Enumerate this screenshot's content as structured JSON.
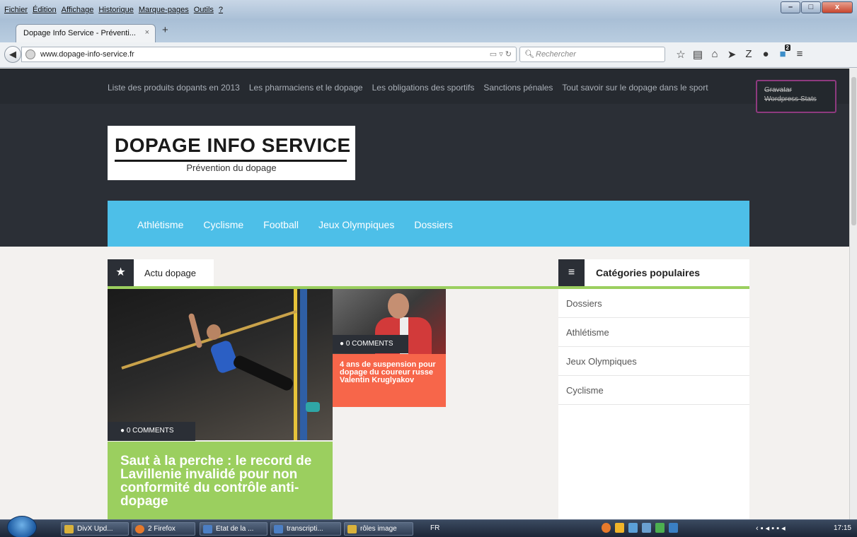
{
  "menubar": {
    "items": [
      "Fichier",
      "Édition",
      "Affichage",
      "Historique",
      "Marque-pages",
      "Outils",
      "?"
    ]
  },
  "tabs": [
    {
      "title": "Dopage Info Service - Préventi...",
      "close": "×"
    }
  ],
  "newtab": "+",
  "urlbar": {
    "url": "www.dopage-info-service.fr"
  },
  "search": {
    "placeholder": "Rechercher"
  },
  "toolbar": {
    "notification_count": "2"
  },
  "site": {
    "top_links": [
      "Liste des produits dopants en 2013",
      "Les pharmaciens et le dopage",
      "Les obligations des sportifs",
      "Sanctions pénales",
      "Tout savoir sur le dopage dans le sport"
    ],
    "plugin_popup": [
      "Gravatar",
      "Wordpress Stats"
    ],
    "logo_title": "DOPAGE INFO SERVICE",
    "logo_subtitle": "Prévention du dopage",
    "categories_nav": [
      "Athlétisme",
      "Cyclisme",
      "Football",
      "Jeux Olympiques",
      "Dossiers"
    ],
    "section_title": "Actu dopage",
    "articles": [
      {
        "comments": "0 COMMENTS",
        "title": "Saut à la perche : le record de Lavillenie invalidé pour non conformité du contrôle anti-dopage"
      },
      {
        "comments": "0 COMMENTS",
        "title": "4 ans de suspension pour dopage du coureur russe Valentin Kruglyakov"
      }
    ],
    "sidebar_title": "Catégories populaires",
    "sidebar_items": [
      "Dossiers",
      "Athlétisme",
      "Jeux Olympiques",
      "Cyclisme"
    ]
  },
  "taskbar": {
    "tasks": [
      "DivX Upd...",
      "2 Firefox",
      "Etat de la ...",
      "transcripti...",
      "rôles image"
    ],
    "lang": "FR",
    "time": "17:15"
  }
}
